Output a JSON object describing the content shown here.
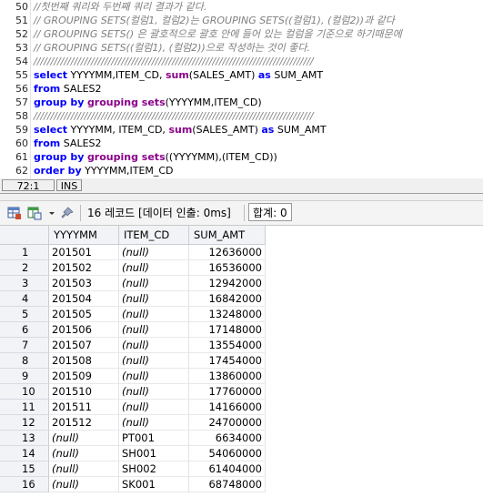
{
  "editor": {
    "lines": [
      {
        "num": "50",
        "segs": [
          {
            "t": "//첫번째 쿼리와 두번째 쿼리 결과가 같다.",
            "c": "cm"
          }
        ]
      },
      {
        "num": "51",
        "segs": [
          {
            "t": "// GROUPING SETS(컬럼1, 컬럼2)는 GROUPING SETS((컬럼1), (컬럼2))과 같다",
            "c": "cm"
          }
        ]
      },
      {
        "num": "52",
        "segs": [
          {
            "t": "// GROUPING SETS() 은 괄호적으로 괄호 안에 들어 있는 컬럼을 기준으로 하기때문에",
            "c": "cm"
          }
        ]
      },
      {
        "num": "53",
        "segs": [
          {
            "t": "// GROUPING SETS((컬럼1), (컬럼2))으로 작성하는 것이 좋다.",
            "c": "cm"
          }
        ]
      },
      {
        "num": "54",
        "segs": [
          {
            "t": "///////////////////////////////////////////////////////////////////////////////////",
            "c": "cm"
          }
        ]
      },
      {
        "num": "55",
        "segs": [
          {
            "t": "select",
            "c": "kw"
          },
          {
            "t": " YYYYMM,ITEM_CD, ",
            "c": "pl"
          },
          {
            "t": "sum",
            "c": "fn"
          },
          {
            "t": "(SALES_AMT) ",
            "c": "pl"
          },
          {
            "t": "as",
            "c": "kw"
          },
          {
            "t": " SUM_AMT",
            "c": "pl"
          }
        ]
      },
      {
        "num": "56",
        "segs": [
          {
            "t": "from",
            "c": "kw"
          },
          {
            "t": " SALES2",
            "c": "pl"
          }
        ]
      },
      {
        "num": "57",
        "segs": [
          {
            "t": "group by",
            "c": "kw"
          },
          {
            "t": " ",
            "c": "pl"
          },
          {
            "t": "grouping sets",
            "c": "fn"
          },
          {
            "t": "(YYYYMM,ITEM_CD)",
            "c": "pl"
          }
        ]
      },
      {
        "num": "58",
        "segs": [
          {
            "t": "///////////////////////////////////////////////////////////////////////////////////",
            "c": "cm"
          }
        ]
      },
      {
        "num": "59",
        "segs": [
          {
            "t": "select",
            "c": "kw"
          },
          {
            "t": " YYYYMM, ITEM_CD, ",
            "c": "pl"
          },
          {
            "t": "sum",
            "c": "fn"
          },
          {
            "t": "(SALES_AMT) ",
            "c": "pl"
          },
          {
            "t": "as",
            "c": "kw"
          },
          {
            "t": " SUM_AMT",
            "c": "pl"
          }
        ]
      },
      {
        "num": "60",
        "segs": [
          {
            "t": "from",
            "c": "kw"
          },
          {
            "t": " SALES2",
            "c": "pl"
          }
        ]
      },
      {
        "num": "61",
        "segs": [
          {
            "t": "group by",
            "c": "kw"
          },
          {
            "t": " ",
            "c": "pl"
          },
          {
            "t": "grouping sets",
            "c": "fn"
          },
          {
            "t": "((YYYYMM),(ITEM_CD))",
            "c": "pl"
          }
        ]
      },
      {
        "num": "62",
        "segs": [
          {
            "t": "order by",
            "c": "kw"
          },
          {
            "t": " YYYYMM,ITEM_CD",
            "c": "pl"
          }
        ]
      }
    ]
  },
  "status": {
    "position": "72:1",
    "mode": "INS"
  },
  "toolbar": {
    "record_info": "16 레코드 [데이터 인출: 0ms]",
    "total": "합계: 0"
  },
  "grid": {
    "columns": [
      "YYYYMM",
      "ITEM_CD",
      "SUM_AMT"
    ],
    "rows": [
      [
        "1",
        "201501",
        "(null)",
        "12636000"
      ],
      [
        "2",
        "201502",
        "(null)",
        "16536000"
      ],
      [
        "3",
        "201503",
        "(null)",
        "12942000"
      ],
      [
        "4",
        "201504",
        "(null)",
        "16842000"
      ],
      [
        "5",
        "201505",
        "(null)",
        "13248000"
      ],
      [
        "6",
        "201506",
        "(null)",
        "17148000"
      ],
      [
        "7",
        "201507",
        "(null)",
        "13554000"
      ],
      [
        "8",
        "201508",
        "(null)",
        "17454000"
      ],
      [
        "9",
        "201509",
        "(null)",
        "13860000"
      ],
      [
        "10",
        "201510",
        "(null)",
        "17760000"
      ],
      [
        "11",
        "201511",
        "(null)",
        "14166000"
      ],
      [
        "12",
        "201512",
        "(null)",
        "24700000"
      ],
      [
        "13",
        "(null)",
        "PT001",
        "6634000"
      ],
      [
        "14",
        "(null)",
        "SH001",
        "54060000"
      ],
      [
        "15",
        "(null)",
        "SH002",
        "61404000"
      ],
      [
        "16",
        "(null)",
        "SK001",
        "68748000"
      ]
    ]
  }
}
